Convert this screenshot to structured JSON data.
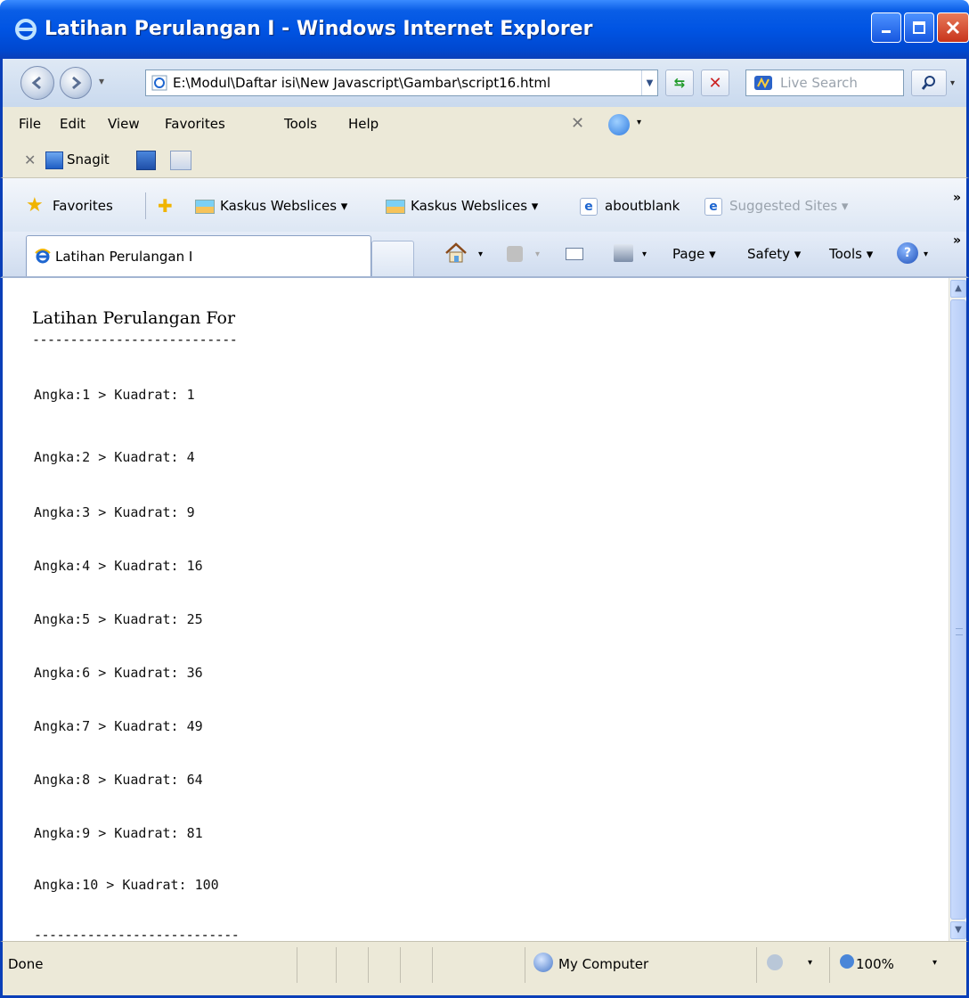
{
  "window": {
    "title": "Latihan Perulangan I - Windows Internet Explorer"
  },
  "address": {
    "url": "E:\\Modul\\Daftar isi\\New Javascript\\Gambar\\script16.html",
    "search_placeholder": "Live Search"
  },
  "menu": [
    "File",
    "Edit",
    "View",
    "Favorites",
    "Tools",
    "Help"
  ],
  "snagit": {
    "label": "Snagit"
  },
  "favorites_bar": {
    "favorites_label": "Favorites",
    "items": [
      {
        "label": "Kaskus Webslices ▾"
      },
      {
        "label": "Kaskus Webslices ▾"
      },
      {
        "label": "aboutblank"
      },
      {
        "label": "Suggested Sites ▾"
      }
    ]
  },
  "tab": {
    "label": "Latihan Perulangan I"
  },
  "command_bar": {
    "page": "Page ▾",
    "safety": "Safety ▾",
    "tools": "Tools ▾"
  },
  "content": {
    "heading": "Latihan Perulangan For",
    "rule": "---------------------------",
    "rows": [
      "Angka:1 > Kuadrat: 1",
      "Angka:2 > Kuadrat: 4",
      "Angka:3 > Kuadrat: 9",
      "Angka:4 > Kuadrat: 16",
      "Angka:5 > Kuadrat: 25",
      "Angka:6 > Kuadrat: 36",
      "Angka:7 > Kuadrat: 49",
      "Angka:8 > Kuadrat: 64",
      "Angka:9 > Kuadrat: 81",
      "Angka:10 > Kuadrat: 100"
    ],
    "rule_bottom": "---------------------------"
  },
  "status": {
    "text": "Done",
    "zone": "My Computer",
    "zoom": "100%"
  }
}
